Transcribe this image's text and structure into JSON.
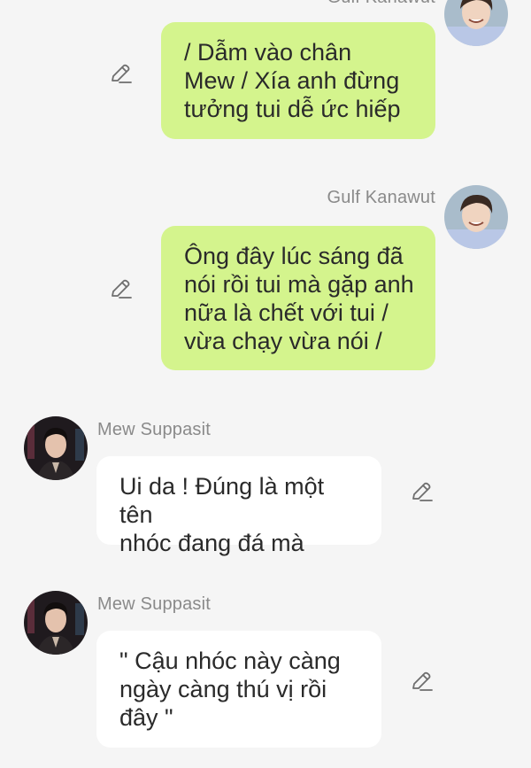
{
  "messages": [
    {
      "sender": "Gulf Kanawut",
      "text": "/ Dẫm vào chân\nMew / Xía anh đừng\ntưởng tui dễ ức hiếp",
      "side": "right"
    },
    {
      "sender": "Gulf Kanawut",
      "text": "Ông đây lúc sáng đã\nnói rồi tui mà gặp anh\nnữa là chết với tui /\nvừa chạy vừa nói /",
      "side": "right"
    },
    {
      "sender": "Mew Suppasit",
      "text": "Ui da ! Đúng là một tên\nnhóc đang đá mà",
      "side": "left"
    },
    {
      "sender": "Mew Suppasit",
      "text": "\" Cậu nhóc này càng\nngày càng thú vị rồi\nđây \"",
      "side": "left"
    }
  ],
  "colors": {
    "right_bubble": "#d4f48d",
    "left_bubble": "#ffffff",
    "background": "#f5f5f5",
    "sender_text": "#8a8a8a"
  },
  "icons": {
    "edit": "pencil-icon"
  }
}
